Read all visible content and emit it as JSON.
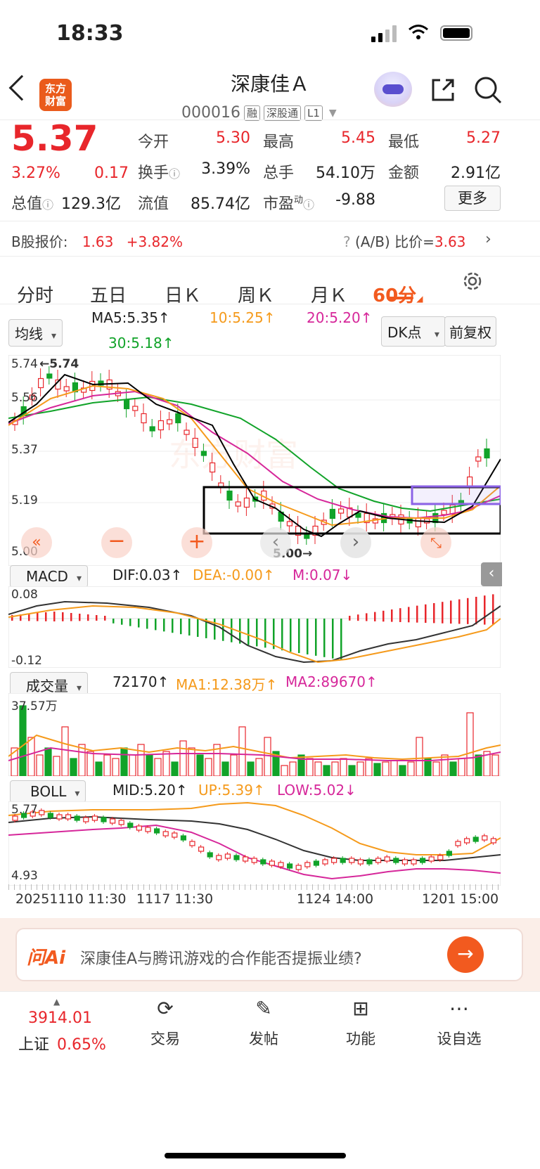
{
  "status": {
    "time": "18:33"
  },
  "header": {
    "logo_line1": "东方",
    "logo_line2": "财富",
    "name": "深康佳Ａ",
    "code": "000016",
    "tags": [
      "融",
      "深股通",
      "L1"
    ]
  },
  "quote": {
    "price": "5.37",
    "change_pct": "3.27%",
    "change_abs": "0.17",
    "open_label": "今开",
    "open": "5.30",
    "high_label": "最高",
    "high": "5.45",
    "low_label": "最低",
    "low": "5.27",
    "turnover_label": "换手",
    "turnover": "3.39%",
    "volume_label": "总手",
    "volume": "54.10万",
    "amount_label": "金额",
    "amount": "2.91亿",
    "mcap_label": "总值",
    "mcap": "129.3亿",
    "float_label": "流值",
    "float": "85.74亿",
    "pe_label": "市盈",
    "pe_sup": "动",
    "pe": "-9.88",
    "more": "更多"
  },
  "bshare": {
    "label": "B股报价:",
    "price": "1.63",
    "pct": "+3.82%",
    "ratio_label": "(A/B) 比价=",
    "ratio": "3.63"
  },
  "tabs": [
    "分时",
    "五日",
    "日Ｋ",
    "周Ｋ",
    "月Ｋ",
    "60分"
  ],
  "active_tab": "60分",
  "ma_legend": {
    "selector": "均线",
    "ma5": "MA5:5.35↑",
    "ma10": "10:5.25↑",
    "ma20": "20:5.20↑",
    "ma30": "30:5.18↑",
    "dk": "DK点",
    "adjust": "前复权"
  },
  "price_axis": {
    "labels": [
      "5.74",
      "5.56",
      "5.37",
      "5.19",
      "5.00"
    ],
    "max_marker": "←5.74",
    "min_marker": "5.00→"
  },
  "macd": {
    "selector": "MACD",
    "dif": "DIF:0.03↑",
    "dea": "DEA:-0.00↑",
    "m": "M:0.07↓",
    "top": "0.08",
    "bottom": "-0.12"
  },
  "volume": {
    "selector": "成交量",
    "value": "72170↑",
    "ma1": "MA1:12.38万↑",
    "ma2": "MA2:89670↑",
    "top": "37.57万"
  },
  "boll": {
    "selector": "BOLL",
    "mid": "MID:5.20↑",
    "up": "UP:5.39↑",
    "low": "LOW:5.02↓",
    "top": "5.77",
    "bottom": "4.93"
  },
  "time_axis": [
    "20251110 11:30",
    "1117 11:30",
    "1124 14:00",
    "1201 15:00"
  ],
  "ai": {
    "brand": "问Ai",
    "question": "深康佳A与腾讯游戏的合作能否提振业绩?"
  },
  "bottom_nav": {
    "index_value": "3914.01",
    "index_name": "上证",
    "index_pct": "0.65%",
    "items": [
      "交易",
      "发帖",
      "功能",
      "设自选"
    ]
  },
  "colors": {
    "up": "#e8262b",
    "down": "#11a329",
    "accent": "#f25a1f",
    "ma10": "#f59a1b",
    "ma20": "#d6279a",
    "ma30": "#11a329"
  }
}
